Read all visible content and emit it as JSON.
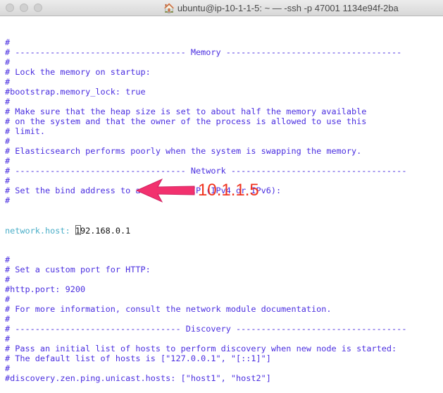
{
  "window": {
    "title": "ubuntu@ip-10-1-1-5: ~ — -ssh -p 47001 1134e94f-2ba"
  },
  "lines": [
    "#",
    "# ---------------------------------- Memory -----------------------------------",
    "#",
    "# Lock the memory on startup:",
    "#",
    "#bootstrap.memory_lock: true",
    "#",
    "# Make sure that the heap size is set to about half the memory available",
    "# on the system and that the owner of the process is allowed to use this",
    "# limit.",
    "#",
    "# Elasticsearch performs poorly when the system is swapping the memory.",
    "#",
    "# ---------------------------------- Network -----------------------------------",
    "#",
    "# Set the bind address to a specific IP (IPv4 or IPv6):",
    "#"
  ],
  "network_host": {
    "key": "network.host:",
    "value": "192.168.0.1"
  },
  "lines_after": [
    "#",
    "# Set a custom port for HTTP:",
    "#",
    "#http.port: 9200",
    "#",
    "# For more information, consult the network module documentation.",
    "#",
    "# --------------------------------- Discovery ----------------------------------",
    "#",
    "# Pass an initial list of hosts to perform discovery when new node is started:",
    "# The default list of hosts is [\"127.0.0.1\", \"[::1]\"]",
    "#",
    "#discovery.zen.ping.unicast.hosts: [\"host1\", \"host2\"]"
  ],
  "annotation": {
    "text": "10.1.1.5",
    "color": "#f0321e",
    "arrow_color": "#f2316e"
  }
}
